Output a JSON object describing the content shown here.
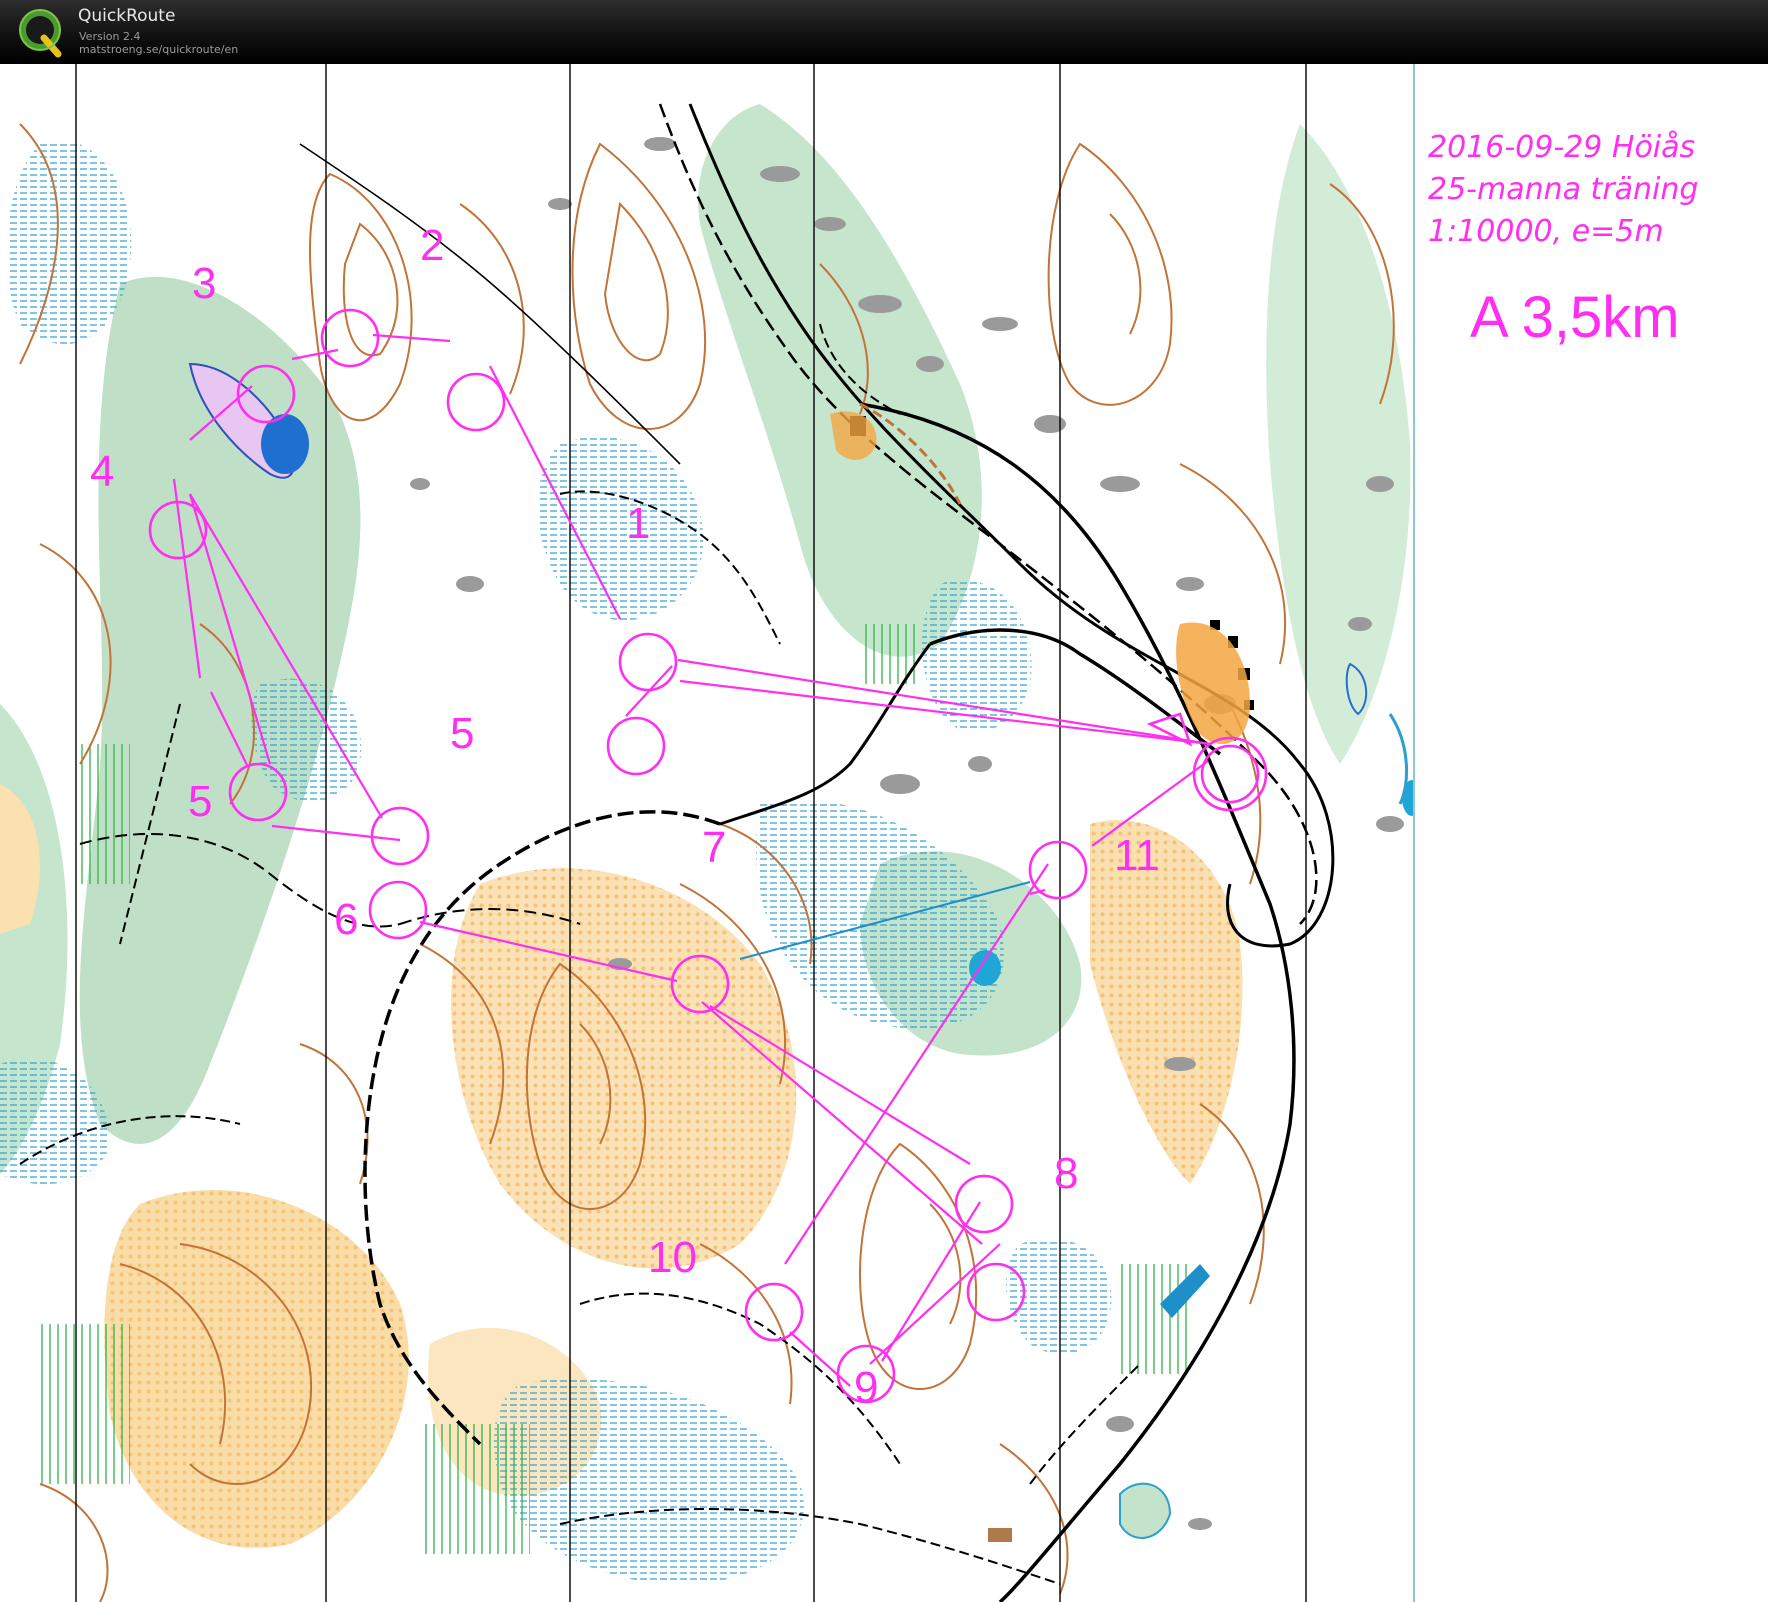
{
  "app": {
    "title": "QuickRoute",
    "version": "Version 2.4",
    "url": "matstroeng.se/quickroute/en",
    "logo_letter": "Q"
  },
  "map_info": {
    "line1": "2016-09-29 Höiås",
    "line2": "25-manna träning",
    "line3": "1:10000, e=5m",
    "course": "A 3,5km"
  },
  "controls": [
    {
      "id": "1",
      "label": "1"
    },
    {
      "id": "2",
      "label": "2"
    },
    {
      "id": "3",
      "label": "3"
    },
    {
      "id": "4",
      "label": "4"
    },
    {
      "id": "5",
      "label": "5"
    },
    {
      "id": "5b",
      "label": "5"
    },
    {
      "id": "6",
      "label": "6"
    },
    {
      "id": "7",
      "label": "7"
    },
    {
      "id": "8",
      "label": "8"
    },
    {
      "id": "9",
      "label": "9"
    },
    {
      "id": "10",
      "label": "10"
    },
    {
      "id": "11",
      "label": "11"
    }
  ],
  "colors": {
    "course_overprint": "#ff2ef0",
    "vegetation_green": "#a9d6b4",
    "open_yellow": "#f8cf8a",
    "contour_brown": "#c0743a",
    "water_blue": "#1f8fc9",
    "rock_grey": "#9a9a9a"
  }
}
